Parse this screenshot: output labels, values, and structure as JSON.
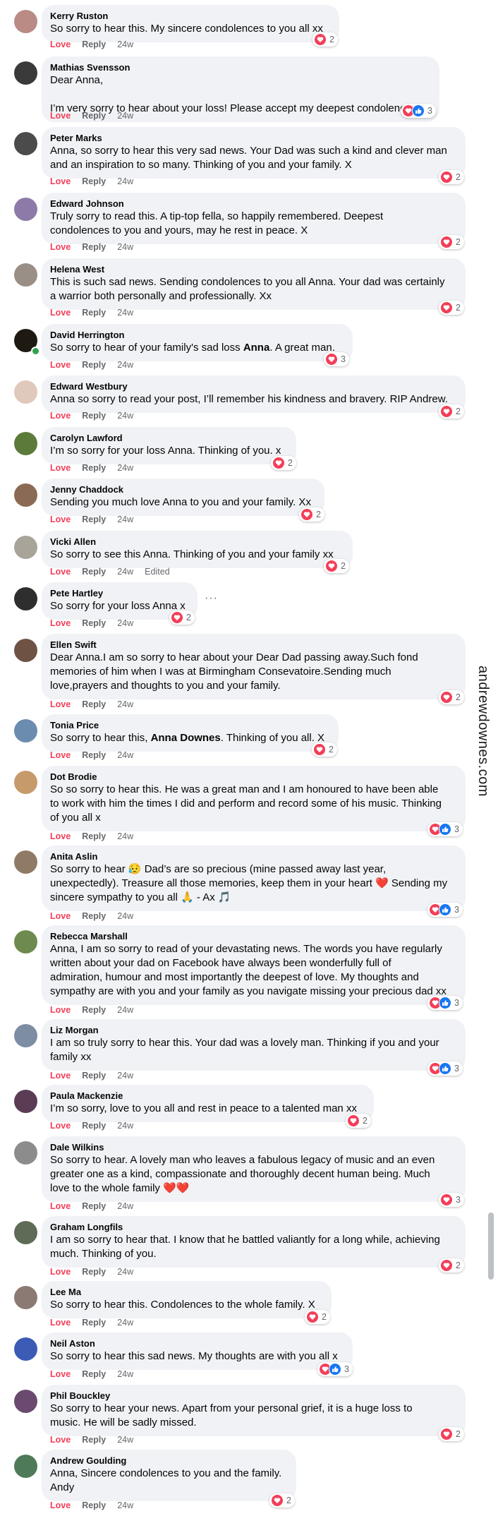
{
  "watermark": "andrewdownes.com",
  "comments": [
    {
      "author": "Kerry Ruston",
      "text": [
        "So sorry to hear this. My sincere condolences to you all xx"
      ],
      "love": "Love",
      "reply": "Reply",
      "time": "24w",
      "reactions": {
        "types": [
          "heart"
        ],
        "count": "2"
      },
      "avatar_color": "#b98b84"
    },
    {
      "author": "Mathias Svensson",
      "text": [
        "Dear Anna,",
        "",
        "I’m very sorry to hear about your loss! Please accept my deepest condolences."
      ],
      "love": "Love",
      "reply": "Reply",
      "time": "24w",
      "reactions": {
        "types": [
          "heart",
          "like"
        ],
        "count": "3"
      },
      "avatar_color": "#3a3a3a"
    },
    {
      "author": "Peter Marks",
      "text": [
        "Anna, so sorry to hear this very sad news. Your Dad was such a kind and clever man",
        "and an inspiration to so many. Thinking of you and your family. X"
      ],
      "love": "Love",
      "reply": "Reply",
      "time": "24w",
      "reactions": {
        "types": [
          "heart"
        ],
        "count": "2"
      },
      "avatar_color": "#4b4b4b"
    },
    {
      "author": "Edward Johnson",
      "text": [
        "Truly sorry to read this. A tip-top fella, so happily remembered. Deepest",
        "condolences to you and yours, may he rest in peace. X"
      ],
      "love": "Love",
      "reply": "Reply",
      "time": "24w",
      "reactions": {
        "types": [
          "heart"
        ],
        "count": "2"
      },
      "avatar_color": "#8d7aa8"
    },
    {
      "author": "Helena West",
      "text": [
        "This is such sad news. Sending condolences to you all Anna. Your dad was certainly",
        "a warrior both personally and professionally. Xx"
      ],
      "love": "Love",
      "reply": "Reply",
      "time": "24w",
      "reactions": {
        "types": [
          "heart"
        ],
        "count": "2"
      },
      "avatar_color": "#9a8f86"
    },
    {
      "author": "David Herrington",
      "text": [
        "So sorry to hear of your family's sad loss {Anna}. A great man."
      ],
      "love": "Love",
      "reply": "Reply",
      "time": "24w",
      "reactions": {
        "types": [
          "heart"
        ],
        "count": "3"
      },
      "avatar_color": "#1e1a12",
      "online": true
    },
    {
      "author": "Edward Westbury",
      "text": [
        "Anna so sorry to read your post, I’ll remember his kindness and bravery. RIP Andrew."
      ],
      "love": "Love",
      "reply": "Reply",
      "time": "24w",
      "reactions": {
        "types": [
          "heart"
        ],
        "count": "2"
      },
      "avatar_color": "#e0c8bd"
    },
    {
      "author": "Carolyn Lawford",
      "text": [
        "I’m so sorry for your loss Anna. Thinking of you. x"
      ],
      "love": "Love",
      "reply": "Reply",
      "time": "24w",
      "reactions": {
        "types": [
          "heart"
        ],
        "count": "2"
      },
      "avatar_color": "#5c7a3a"
    },
    {
      "author": "Jenny Chaddock",
      "text": [
        "Sending you much love Anna to you and your family. Xx"
      ],
      "love": "Love",
      "reply": "Reply",
      "time": "24w",
      "reactions": {
        "types": [
          "heart"
        ],
        "count": "2"
      },
      "avatar_color": "#8a6a54"
    },
    {
      "author": "Vicki Allen",
      "text": [
        "So sorry to see this Anna. Thinking of you and your family xx"
      ],
      "love": "Love",
      "reply": "Reply",
      "time": "24w",
      "edited": "Edited",
      "reactions": {
        "types": [
          "heart"
        ],
        "count": "2"
      },
      "avatar_color": "#a8a49a"
    },
    {
      "author": "Pete Hartley",
      "text": [
        "So sorry for your loss Anna x"
      ],
      "love": "Love",
      "reply": "Reply",
      "time": "24w",
      "reactions": {
        "types": [
          "heart"
        ],
        "count": "2"
      },
      "avatar_color": "#2e2e2e",
      "more": "···"
    },
    {
      "author": "Ellen Swift",
      "text": [
        "Dear Anna.I am so sorry to hear about your Dear Dad passing away.Such fond",
        "memories of him when I was at Birmingham Consevatoire.Sending much",
        "love,prayers and thoughts to you and your family."
      ],
      "love": "Love",
      "reply": "Reply",
      "time": "24w",
      "reactions": {
        "types": [
          "heart"
        ],
        "count": "2"
      },
      "avatar_color": "#6e5244"
    },
    {
      "author": "Tonia Price",
      "text": [
        "So sorry to hear this, {Anna Downes}. Thinking of you all. X"
      ],
      "love": "Love",
      "reply": "Reply",
      "time": "24w",
      "reactions": {
        "types": [
          "heart"
        ],
        "count": "2"
      },
      "avatar_color": "#6b8cae"
    },
    {
      "author": "Dot Brodie",
      "text": [
        "So so sorry to hear this. He was a great man and I am honoured to have been able",
        "to work with him the times I did and perform and record some of his music. Thinking",
        "of you all x"
      ],
      "love": "Love",
      "reply": "Reply",
      "time": "24w",
      "reactions": {
        "types": [
          "heart",
          "like"
        ],
        "count": "3"
      },
      "avatar_color": "#c79a6b"
    },
    {
      "author": "Anita Aslin",
      "text": [
        "So sorry to hear 😥 Dad’s are so precious (mine passed away last year,",
        "unexpectedly). Treasure all those memories, keep them in your heart ❤️ Sending my",
        "sincere sympathy to you all 🙏 - Ax 🎵"
      ],
      "love": "Love",
      "reply": "Reply",
      "time": "24w",
      "reactions": {
        "types": [
          "heart",
          "like"
        ],
        "count": "3"
      },
      "avatar_color": "#8f7b65"
    },
    {
      "author": "Rebecca Marshall",
      "text": [
        "Anna, I am so sorry to read of your devastating news. The words you have regularly",
        "written about your dad on Facebook have always been wonderfully full of",
        "admiration, humour and most importantly the deepest of love. My thoughts and",
        "sympathy are with you and your family as you navigate missing your precious dad xx"
      ],
      "love": "Love",
      "reply": "Reply",
      "time": "24w",
      "reactions": {
        "types": [
          "heart",
          "like"
        ],
        "count": "3"
      },
      "avatar_color": "#6f8a4e"
    },
    {
      "author": "Liz Morgan",
      "text": [
        "I am so truly sorry to hear this. Your dad was a lovely man. Thinking if you and your",
        "family xx"
      ],
      "love": "Love",
      "reply": "Reply",
      "time": "24w",
      "reactions": {
        "types": [
          "heart",
          "like"
        ],
        "count": "3"
      },
      "avatar_color": "#7d8da3"
    },
    {
      "author": "Paula Mackenzie",
      "text": [
        "I’m so sorry, love to you all and rest in peace to a talented man xx"
      ],
      "love": "Love",
      "reply": "Reply",
      "time": "24w",
      "reactions": {
        "types": [
          "heart"
        ],
        "count": "2"
      },
      "avatar_color": "#5a3c55"
    },
    {
      "author": "Dale Wilkins",
      "text": [
        "So sorry to hear. A lovely man who leaves a fabulous legacy of music and an even",
        "greater one as a kind, compassionate and thoroughly decent human being. Much",
        "love to the whole family ❤️❤️"
      ],
      "love": "Love",
      "reply": "Reply",
      "time": "24w",
      "reactions": {
        "types": [
          "heart"
        ],
        "count": "3"
      },
      "avatar_color": "#8c8c8c"
    },
    {
      "author": "Graham Longfils",
      "text": [
        "I am so sorry to hear that. I know that he battled valiantly for a long while, achieving",
        "much. Thinking of you."
      ],
      "love": "Love",
      "reply": "Reply",
      "time": "24w",
      "reactions": {
        "types": [
          "heart"
        ],
        "count": "2"
      },
      "avatar_color": "#5d6b57"
    },
    {
      "author": "Lee Ma",
      "text": [
        "So sorry to hear this. Condolences to the whole family. X"
      ],
      "love": "Love",
      "reply": "Reply",
      "time": "24w",
      "reactions": {
        "types": [
          "heart"
        ],
        "count": "2"
      },
      "avatar_color": "#8b7a74"
    },
    {
      "author": "Neil Aston",
      "text": [
        "So sorry to hear this sad news. My thoughts are with you all x"
      ],
      "love": "Love",
      "reply": "Reply",
      "time": "24w",
      "reactions": {
        "types": [
          "heart",
          "like"
        ],
        "count": "3"
      },
      "avatar_color": "#3b5bb5"
    },
    {
      "author": "Phil Bouckley",
      "text": [
        "So sorry to hear your news. Apart from your personal grief, it is a huge loss to",
        "music. He will be sadly missed."
      ],
      "love": "Love",
      "reply": "Reply",
      "time": "24w",
      "reactions": {
        "types": [
          "heart"
        ],
        "count": "2"
      },
      "avatar_color": "#6a4a6e"
    },
    {
      "author": "Andrew Goulding",
      "text": [
        "Anna, Sincere condolences to you and the family.",
        "Andy"
      ],
      "love": "Love",
      "reply": "Reply",
      "time": "24w",
      "reactions": {
        "types": [
          "heart"
        ],
        "count": "2"
      },
      "avatar_color": "#4f7a5a"
    }
  ]
}
